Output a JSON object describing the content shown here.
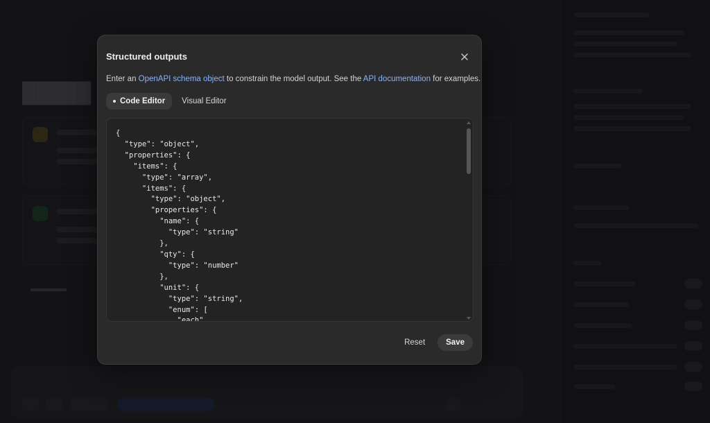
{
  "dialog": {
    "title": "Structured outputs",
    "description": {
      "prefix": "Enter an ",
      "schema_link": "OpenAPI schema object",
      "middle": " to constrain the model output. See the ",
      "docs_link": "API documentation",
      "suffix": " for examples."
    },
    "tabs": [
      {
        "label": "Code Editor",
        "active": true
      },
      {
        "label": "Visual Editor",
        "active": false
      }
    ],
    "code": "{\n  \"type\": \"object\",\n  \"properties\": {\n    \"items\": {\n      \"type\": \"array\",\n      \"items\": {\n        \"type\": \"object\",\n        \"properties\": {\n          \"name\": {\n            \"type\": \"string\"\n          },\n          \"qty\": {\n            \"type\": \"number\"\n          },\n          \"unit\": {\n            \"type\": \"string\",\n            \"enum\": [\n              \"each\",",
    "reset_label": "Reset",
    "save_label": "Save"
  },
  "colors": {
    "link": "#8ab4f8",
    "dialog_bg": "#2a2a2b",
    "editor_bg": "#232324"
  }
}
